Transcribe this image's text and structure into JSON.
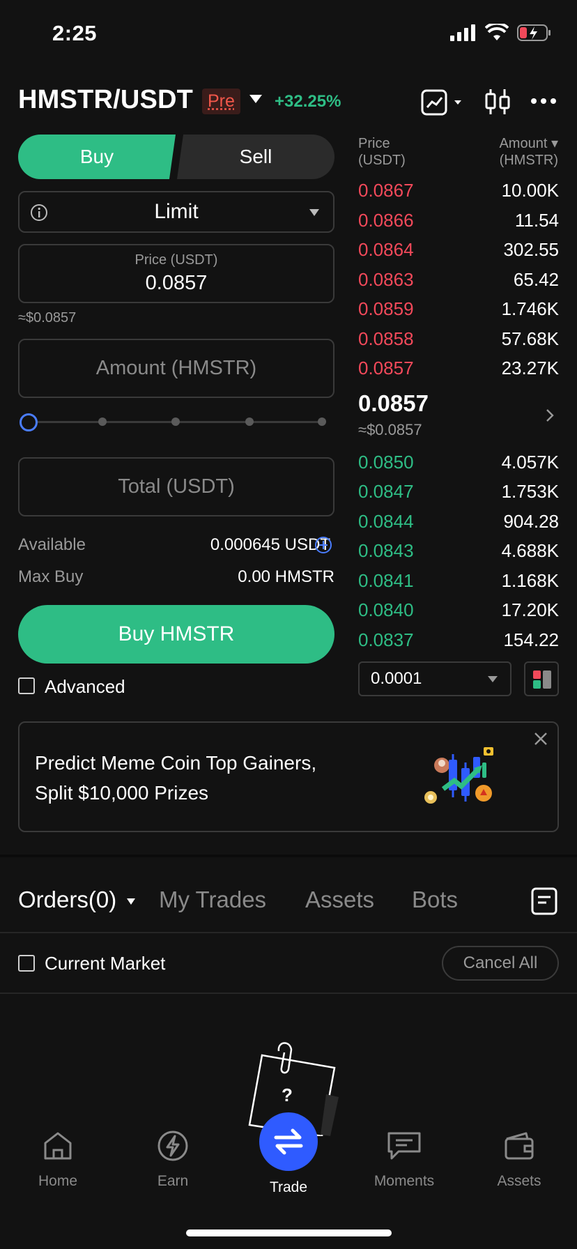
{
  "status_bar": {
    "time": "2:25"
  },
  "header": {
    "pair": "HMSTR/USDT",
    "badge": "Pre",
    "change": "+32.25%"
  },
  "trade_form": {
    "buy_tab": "Buy",
    "sell_tab": "Sell",
    "order_type": "Limit",
    "price_label": "Price (USDT)",
    "price_value": "0.0857",
    "price_approx": "≈$0.0857",
    "amount_placeholder": "Amount (HMSTR)",
    "slider_percent": 0,
    "total_placeholder": "Total (USDT)",
    "available_label": "Available",
    "available_value": "0.000645 USDT",
    "max_buy_label": "Max Buy",
    "max_buy_value": "0.00 HMSTR",
    "buy_button": "Buy HMSTR",
    "advanced_label": "Advanced"
  },
  "order_book": {
    "price_header": "Price",
    "price_unit": "(USDT)",
    "amount_header": "Amount ▾",
    "amount_unit": "(HMSTR)",
    "asks": [
      {
        "price": "0.0867",
        "amount": "10.00K"
      },
      {
        "price": "0.0866",
        "amount": "11.54"
      },
      {
        "price": "0.0864",
        "amount": "302.55"
      },
      {
        "price": "0.0863",
        "amount": "65.42"
      },
      {
        "price": "0.0859",
        "amount": "1.746K"
      },
      {
        "price": "0.0858",
        "amount": "57.68K"
      },
      {
        "price": "0.0857",
        "amount": "23.27K"
      }
    ],
    "last_price": "0.0857",
    "last_approx": "≈$0.0857",
    "bids": [
      {
        "price": "0.0850",
        "amount": "4.057K"
      },
      {
        "price": "0.0847",
        "amount": "1.753K"
      },
      {
        "price": "0.0844",
        "amount": "904.28"
      },
      {
        "price": "0.0843",
        "amount": "4.688K"
      },
      {
        "price": "0.0841",
        "amount": "1.168K"
      },
      {
        "price": "0.0840",
        "amount": "17.20K"
      },
      {
        "price": "0.0837",
        "amount": "154.22"
      }
    ],
    "depth": "0.0001"
  },
  "promo": {
    "line1": "Predict Meme Coin Top Gainers,",
    "line2": "Split $10,000 Prizes"
  },
  "orders": {
    "tabs": [
      "Orders(0)",
      "My Trades",
      "Assets",
      "Bots"
    ],
    "current_market_label": "Current Market",
    "cancel_all": "Cancel All",
    "empty_mark": "?"
  },
  "bottom_nav": {
    "items": [
      "Home",
      "Earn",
      "Trade",
      "Moments",
      "Assets"
    ]
  },
  "colors": {
    "green": "#2ebd85",
    "red": "#f2495a",
    "accent_blue": "#2f5bff"
  }
}
